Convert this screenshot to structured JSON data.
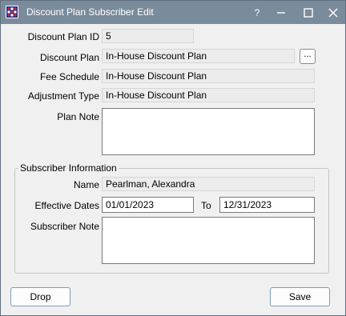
{
  "window": {
    "title": "Discount Plan Subscriber Edit",
    "help_label": "?",
    "icon": "open-dental-grid-icon"
  },
  "form": {
    "discount_plan_id_label": "Discount Plan ID",
    "discount_plan_id_value": "5",
    "discount_plan_label": "Discount Plan",
    "discount_plan_value": "In-House Discount Plan",
    "ellipsis_label": "...",
    "fee_schedule_label": "Fee Schedule",
    "fee_schedule_value": "In-House Discount Plan",
    "adjustment_type_label": "Adjustment Type",
    "adjustment_type_value": "In-House Discount Plan",
    "plan_note_label": "Plan Note",
    "plan_note_value": ""
  },
  "subscriber": {
    "group_title": "Subscriber Information",
    "name_label": "Name",
    "name_value": "Pearlman, Alexandra",
    "effective_dates_label": "Effective Dates",
    "start_date": "01/01/2023",
    "to_label": "To",
    "end_date": "12/31/2023",
    "note_label": "Subscriber Note",
    "note_value": ""
  },
  "buttons": {
    "drop_label": "Drop",
    "save_label": "Save"
  },
  "colors": {
    "titlebar": "#7a8b9b",
    "window_bg": "#f0f0f0",
    "readonly_field_bg": "#ececec"
  }
}
